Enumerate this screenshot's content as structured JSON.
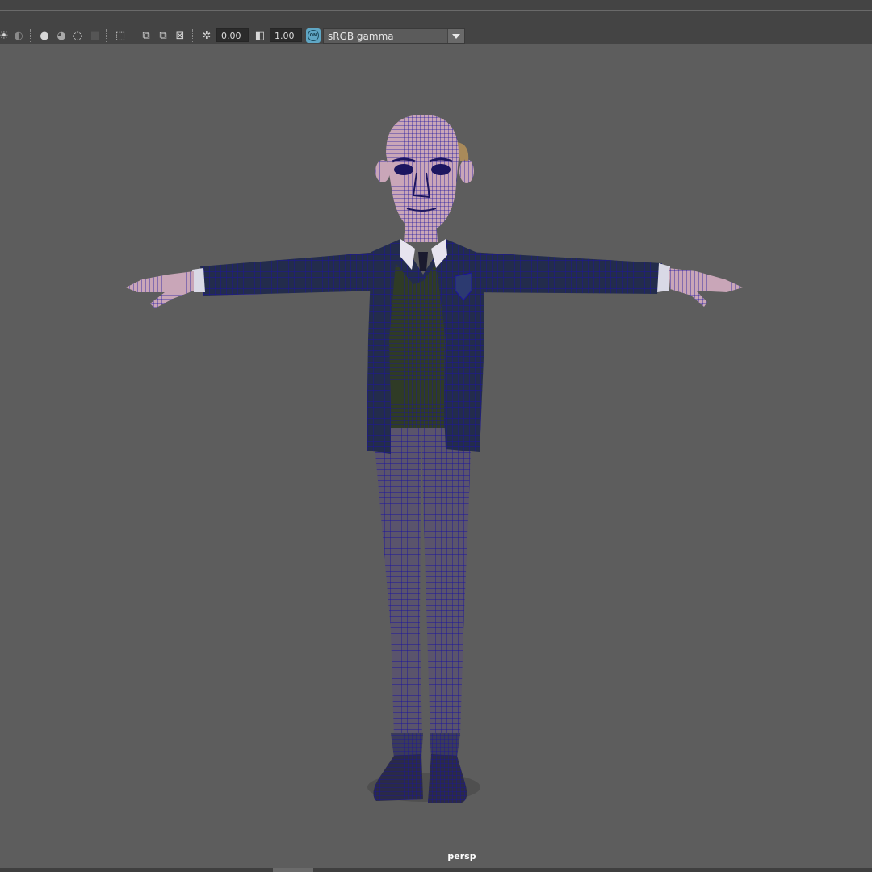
{
  "toolbar": {
    "exposure_value": "0.00",
    "gamma_value": "1.00",
    "color_management_badge": "ON",
    "view_transform": "sRGB gamma",
    "icons": [
      "light-icon",
      "shadow-icon",
      "ambient-occlusion-icon",
      "motion-blur-icon",
      "antialiasing-icon",
      "depth-of-field-icon",
      "isolate-select-icon",
      "xray-icon",
      "xray-joints-icon",
      "backface-icon",
      "exposure-icon",
      "gamma-icon"
    ]
  },
  "viewport": {
    "camera_label": "persp",
    "colors": {
      "background": "#5d5d5d",
      "wireframe": "#1c149e",
      "skin": "#c9a6b8",
      "jacket": "#232c4c",
      "vest": "#2f3b26",
      "trousers": "#5a546c"
    }
  }
}
